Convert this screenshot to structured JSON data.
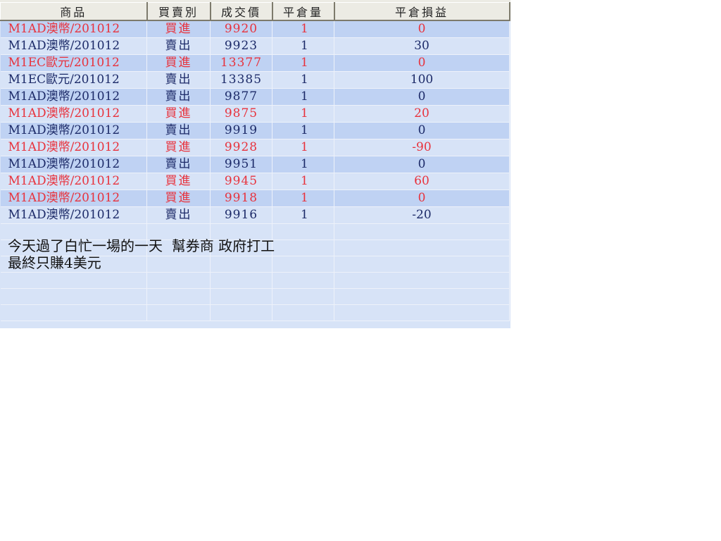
{
  "table": {
    "headers": [
      "商品",
      "買賣別",
      "成交價",
      "平倉量",
      "平倉損益"
    ],
    "rows": [
      {
        "product": "M1AD澳幣/201012",
        "side": "買進",
        "price": "9920",
        "qty": "1",
        "pnl": "0",
        "type": "buy"
      },
      {
        "product": "M1AD澳幣/201012",
        "side": "賣出",
        "price": "9923",
        "qty": "1",
        "pnl": "30",
        "type": "sell"
      },
      {
        "product": "M1EC歐元/201012",
        "side": "買進",
        "price": "13377",
        "qty": "1",
        "pnl": "0",
        "type": "buy"
      },
      {
        "product": "M1EC歐元/201012",
        "side": "賣出",
        "price": "13385",
        "qty": "1",
        "pnl": "100",
        "type": "sell"
      },
      {
        "product": "M1AD澳幣/201012",
        "side": "賣出",
        "price": "9877",
        "qty": "1",
        "pnl": "0",
        "type": "sell"
      },
      {
        "product": "M1AD澳幣/201012",
        "side": "買進",
        "price": "9875",
        "qty": "1",
        "pnl": "20",
        "type": "buy"
      },
      {
        "product": "M1AD澳幣/201012",
        "side": "賣出",
        "price": "9919",
        "qty": "1",
        "pnl": "0",
        "type": "sell"
      },
      {
        "product": "M1AD澳幣/201012",
        "side": "買進",
        "price": "9928",
        "qty": "1",
        "pnl": "-90",
        "type": "buy"
      },
      {
        "product": "M1AD澳幣/201012",
        "side": "賣出",
        "price": "9951",
        "qty": "1",
        "pnl": "0",
        "type": "sell"
      },
      {
        "product": "M1AD澳幣/201012",
        "side": "買進",
        "price": "9945",
        "qty": "1",
        "pnl": "60",
        "type": "buy"
      },
      {
        "product": "M1AD澳幣/201012",
        "side": "買進",
        "price": "9918",
        "qty": "1",
        "pnl": "0",
        "type": "buy"
      },
      {
        "product": "M1AD澳幣/201012",
        "side": "賣出",
        "price": "9916",
        "qty": "1",
        "pnl": "-20",
        "type": "sell"
      }
    ]
  },
  "comment": {
    "line1": "今天過了白忙一場的一天  幫券商 政府打工",
    "line2": "最終只賺4美元"
  },
  "colors": {
    "buy_text": "#e8323c",
    "sell_text": "#1c2a68",
    "row_odd_bg": "#bfd2f3",
    "row_even_bg": "#d7e3f7",
    "header_bg": "#ecebe4"
  }
}
